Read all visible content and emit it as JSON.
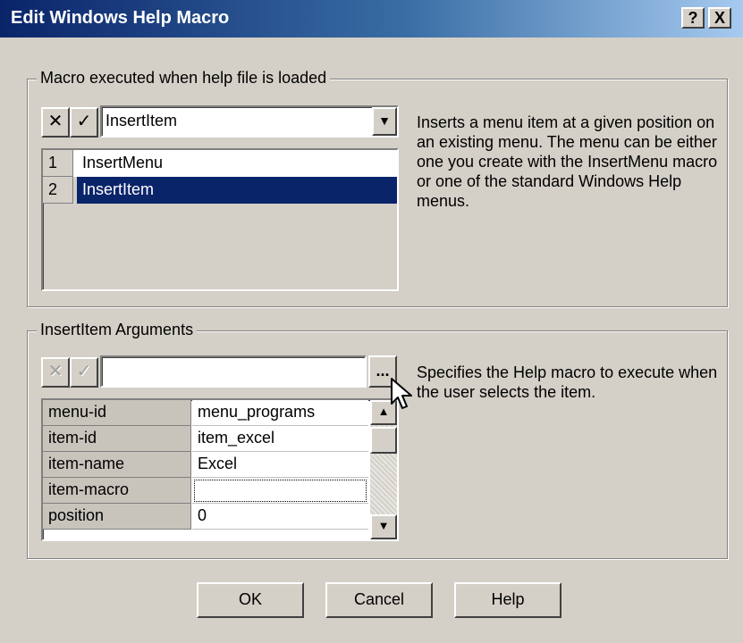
{
  "window": {
    "title": "Edit Windows Help Macro",
    "help_button": "?",
    "close_button": "X"
  },
  "macro_group": {
    "label": "Macro executed when help file is loaded",
    "cancel_glyph": "✕",
    "accept_glyph": "✓",
    "combo_value": "InsertItem",
    "dropdown_glyph": "▼",
    "list": [
      {
        "num": "1",
        "name": "InsertMenu",
        "selected": false
      },
      {
        "num": "2",
        "name": "InsertItem",
        "selected": true
      }
    ],
    "description": "Inserts a menu item at a given position on an existing menu. The menu can be either one you create with the InsertMenu macro or one of the standard Windows Help menus."
  },
  "args_group": {
    "label": "InsertItem Arguments",
    "cancel_glyph": "✕",
    "accept_glyph": "✓",
    "edit_value": "",
    "browse_label": "...",
    "rows": [
      {
        "name": "menu-id",
        "value": "menu_programs"
      },
      {
        "name": "item-id",
        "value": "item_excel"
      },
      {
        "name": "item-name",
        "value": "Excel"
      },
      {
        "name": "item-macro",
        "value": ""
      },
      {
        "name": "position",
        "value": "0"
      }
    ],
    "scroll_up_glyph": "▲",
    "scroll_down_glyph": "▼",
    "description": "Specifies the Help macro to execute when the user selects the item."
  },
  "buttons": {
    "ok": "OK",
    "cancel": "Cancel",
    "help": "Help"
  }
}
